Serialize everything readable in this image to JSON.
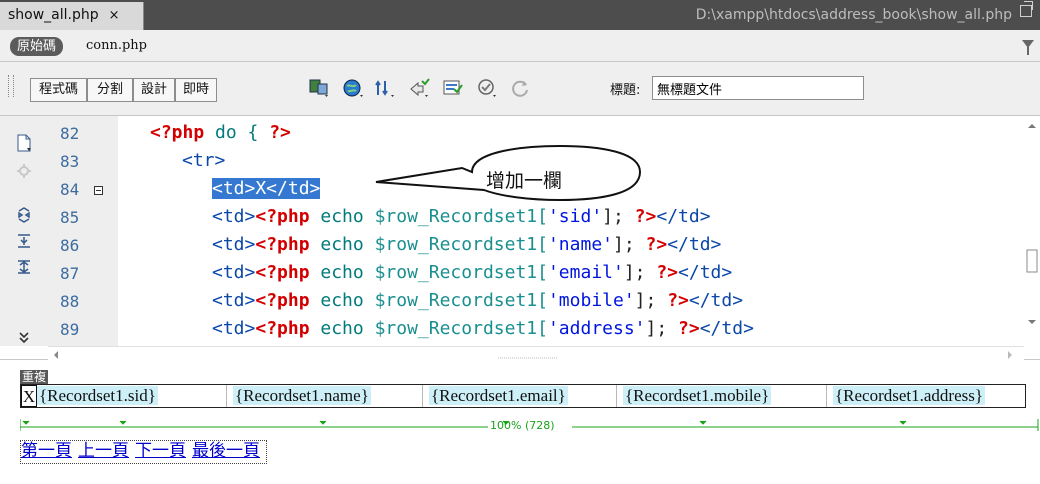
{
  "tab": {
    "name": "show_all.php",
    "close": "×"
  },
  "file_path": "D:\\xampp\\htdocs\\address_book\\show_all.php",
  "related": {
    "source_button": "原始碼",
    "file": "conn.php"
  },
  "toolbar": {
    "views": [
      "程式碼",
      "分割",
      "設計",
      "即時"
    ],
    "title_label": "標題:",
    "title_value": "無標題文件"
  },
  "code": {
    "line_numbers": [
      "82",
      "83",
      "84",
      "85",
      "86",
      "87",
      "88",
      "89"
    ],
    "callout": "增加一欄",
    "lines": {
      "l82": {
        "php_open": "<?php",
        "kw": " do { ",
        "php_close": "?>"
      },
      "l83": {
        "tag": "<tr>"
      },
      "l84": {
        "selected": "<td>X</td>"
      },
      "l85": {
        "td_open": "<td>",
        "php_open": "<?php",
        "echo": " echo ",
        "var": "$row_Recordset1[",
        "str": "'sid'",
        "rest": "]; ",
        "php_close": "?>",
        "td_close": "</td>"
      },
      "l86": {
        "td_open": "<td>",
        "php_open": "<?php",
        "echo": " echo ",
        "var": "$row_Recordset1[",
        "str": "'name'",
        "rest": "]; ",
        "php_close": "?>",
        "td_close": "</td>"
      },
      "l87": {
        "td_open": "<td>",
        "php_open": "<?php",
        "echo": " echo ",
        "var": "$row_Recordset1[",
        "str": "'email'",
        "rest": "]; ",
        "php_close": "?>",
        "td_close": "</td>"
      },
      "l88": {
        "td_open": "<td>",
        "php_open": "<?php",
        "echo": " echo ",
        "var": "$row_Recordset1[",
        "str": "'mobile'",
        "rest": "]; ",
        "php_close": "?>",
        "td_close": "</td>"
      },
      "l89": {
        "td_open": "<td>",
        "php_open": "<?php",
        "echo": " echo ",
        "var": "$row_Recordset1[",
        "str": "'address'",
        "rest": "]; ",
        "php_close": "?>",
        "td_close": "</td>"
      }
    }
  },
  "design": {
    "repeat_label": "重複",
    "cells": [
      "X",
      "{Recordset1.sid}",
      "{Recordset1.name}",
      "{Recordset1.email}",
      "{Recordset1.mobile}",
      "{Recordset1.address}"
    ],
    "width_label": "100% (728)",
    "nav": [
      "第一頁",
      "上一頁",
      "下一頁",
      "最後一頁"
    ]
  },
  "colors": {
    "php_tag": "#d40000",
    "selection": "#3478d1",
    "binding_bg": "#cdeff7",
    "guide": "#19a319"
  }
}
